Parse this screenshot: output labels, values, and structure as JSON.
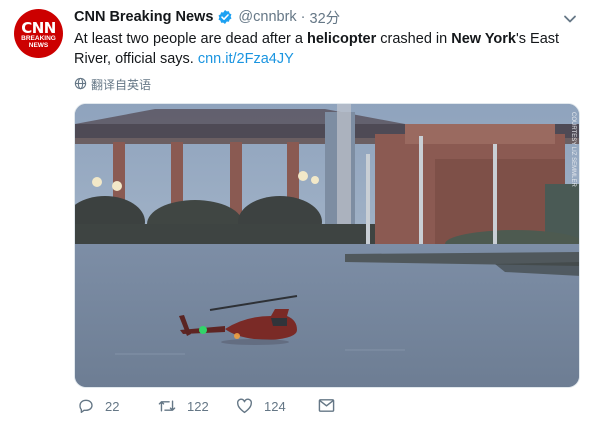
{
  "account": {
    "name": "CNN Breaking News",
    "handle": "@cnnbrk",
    "separator": "·",
    "time": "32分",
    "avatar_logo": "CNN",
    "avatar_sub": "BREAKING NEWS"
  },
  "tweet": {
    "text_parts": [
      {
        "t": "At least two people are dead after a ",
        "b": false
      },
      {
        "t": "helicopter",
        "b": true
      },
      {
        "t": " crashed in ",
        "b": false
      },
      {
        "t": "New York",
        "b": true
      },
      {
        "t": "'s East River, official says. ",
        "b": false
      }
    ],
    "link": "cnn.it/2Fza4JY",
    "translate_label": "翻译自英语"
  },
  "media": {
    "watermark": "COURTESY LIZ SEMMLER"
  },
  "actions": {
    "reply_count": "22",
    "retweet_count": "122",
    "like_count": "124"
  },
  "colors": {
    "brand": "#cc0000",
    "link": "#1b95e0",
    "muted": "#657786",
    "verified": "#1da1f2"
  },
  "icons": [
    "verified-badge-icon",
    "chevron-down-icon",
    "globe-icon",
    "reply-icon",
    "retweet-icon",
    "like-icon",
    "message-icon"
  ]
}
